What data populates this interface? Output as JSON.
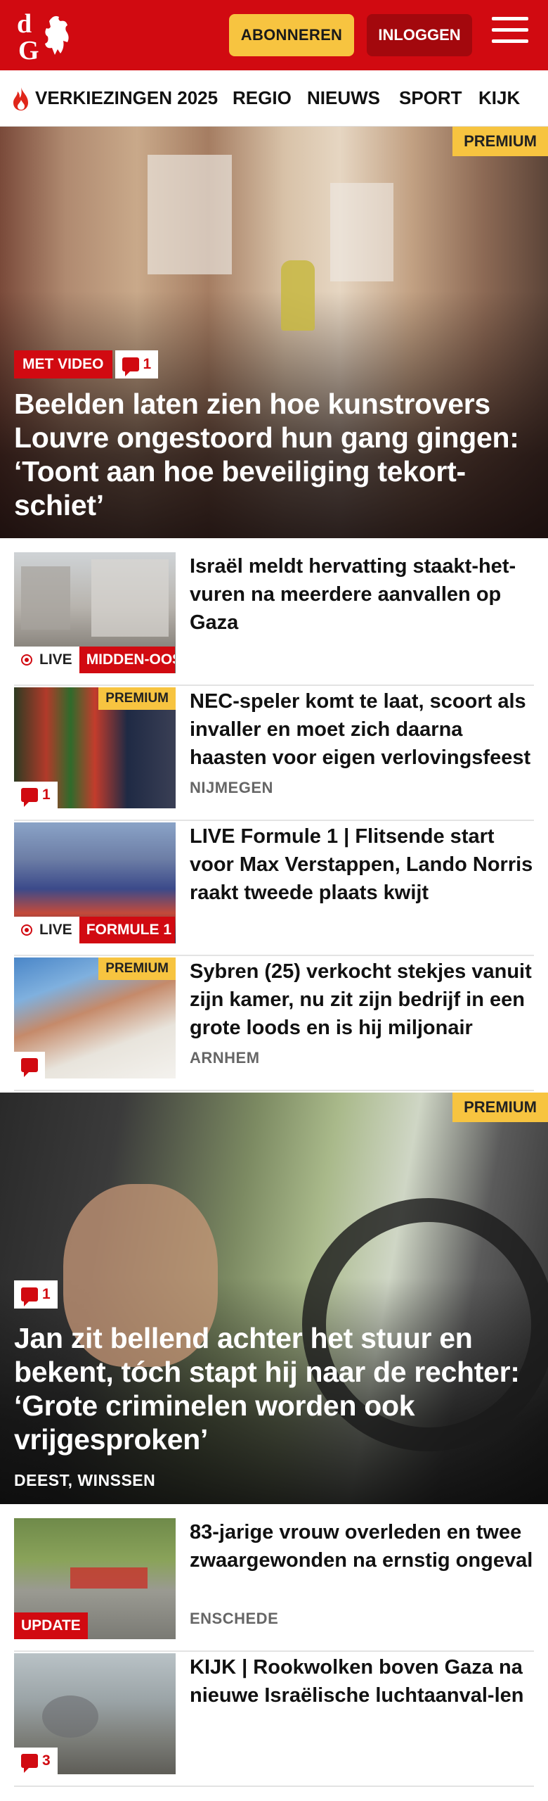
{
  "header": {
    "logo_letters": "dG",
    "subscribe_label": "ABONNEREN",
    "login_label": "INLOGGEN"
  },
  "nav": {
    "items": [
      "VERKIEZINGEN 2025",
      "REGIO",
      "NIEUWS",
      "SPORT",
      "KIJK"
    ]
  },
  "hero1": {
    "premium": "PREMIUM",
    "tag": "MET VIDEO",
    "comments": "1",
    "title": "Beelden laten zien hoe kunstrovers Louvre ongestoord hun gang gingen: ‘Toont aan hoe beveiliging tekort-schiet’"
  },
  "articles": [
    {
      "title": "Israël meldt hervatting staakt-het-vuren na meerdere aanvallen op Gaza",
      "live": "LIVE",
      "category": "MIDDEN-OOSTEN"
    },
    {
      "title": "NEC-speler komt te laat, scoort als invaller en moet zich daarna haasten voor eigen verlovings­feest",
      "premium": "PREMIUM",
      "comments": "1",
      "location": "NIJMEGEN"
    },
    {
      "title": "LIVE Formule 1 | Flitsende start voor Max Verstappen, Lando Norris raakt tweede plaats kwijt",
      "live": "LIVE",
      "category": "FORMULE 1"
    },
    {
      "title": "Sybren (25) verkocht stekjes vanuit zijn kamer, nu zit zijn bedrijf in een grote loods en is hij miljonair",
      "premium": "PREMIUM",
      "location": "ARNHEM"
    }
  ],
  "hero2": {
    "premium": "PREMIUM",
    "comments": "1",
    "title": "Jan zit bellend achter het stuur en bekent, tóch stapt hij naar de rechter: ‘Grote criminelen worden ook vrijgesproken’",
    "location": "DEEST, WINSSEN"
  },
  "articles2": [
    {
      "title": "83-jarige vrouw overleden en twee zwaargewonden na ernstig ongeval",
      "tag": "UPDATE",
      "location": "ENSCHEDE"
    },
    {
      "title": "KIJK | Rookwolken boven Gaza na nieuwe Israëlische luchtaanval-len",
      "comments": "3"
    }
  ]
}
